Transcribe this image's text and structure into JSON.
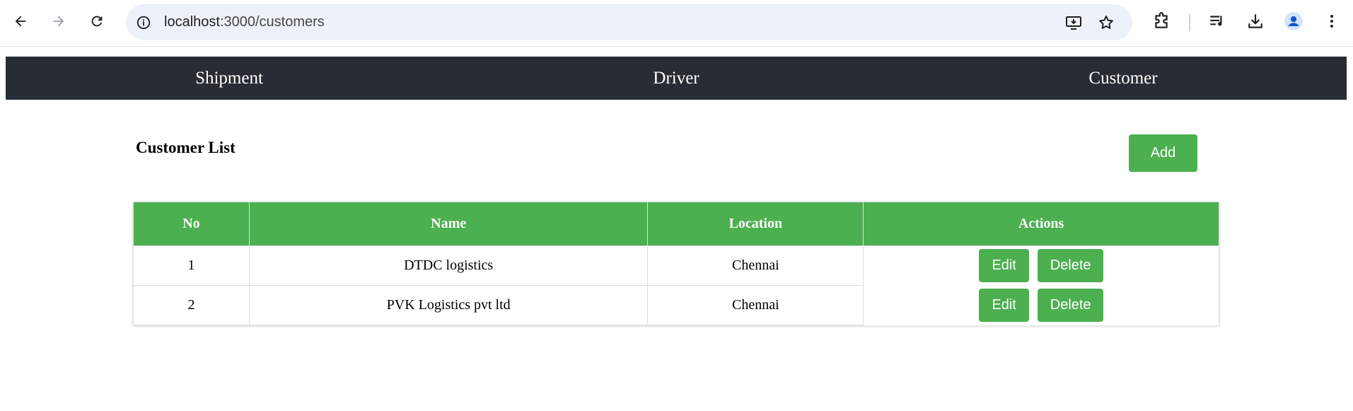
{
  "browser": {
    "url_host": "localhost",
    "url_path": ":3000/customers"
  },
  "navbar": {
    "items": [
      {
        "label": "Shipment"
      },
      {
        "label": "Driver"
      },
      {
        "label": "Customer"
      }
    ]
  },
  "page": {
    "title": "Customer List",
    "add_label": "Add"
  },
  "table": {
    "headers": [
      "No",
      "Name",
      "Location",
      "Actions"
    ],
    "rows": [
      {
        "no": "1",
        "name": "DTDC logistics",
        "location": "Chennai",
        "edit": "Edit",
        "delete": "Delete"
      },
      {
        "no": "2",
        "name": "PVK Logistics pvt ltd",
        "location": "Chennai",
        "edit": "Edit",
        "delete": "Delete"
      }
    ]
  },
  "colors": {
    "accent": "#4caf50",
    "navbar_bg": "#282c34",
    "omnibox_bg": "#edf2fa"
  }
}
